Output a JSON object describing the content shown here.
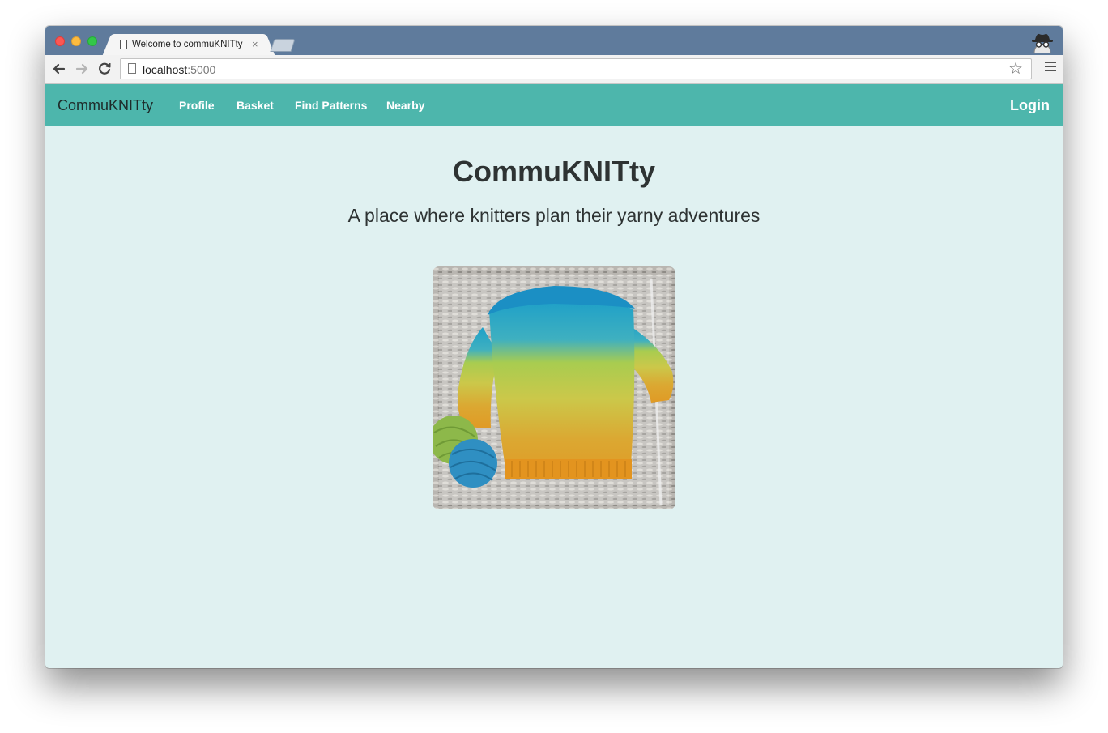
{
  "browser": {
    "tab_title": "Welcome to commuKNITty",
    "tab_close": "×",
    "url_host": "localhost",
    "url_port": ":5000",
    "icons": [
      "back-arrow-icon",
      "forward-arrow-icon",
      "reload-icon",
      "page-icon",
      "star-icon",
      "menu-icon",
      "incognito-icon"
    ]
  },
  "navbar": {
    "brand": "CommuKNITty",
    "links": [
      "Profile",
      "Basket",
      "Find Patterns",
      "Nearby"
    ],
    "login": "Login",
    "color": "#4db6ac"
  },
  "hero": {
    "title": "CommuKNITty",
    "subtitle": "A place where knitters plan their yarny adventures"
  },
  "colors": {
    "page_background": "#e0f1f1",
    "titlebar": "#5f7b9c"
  }
}
